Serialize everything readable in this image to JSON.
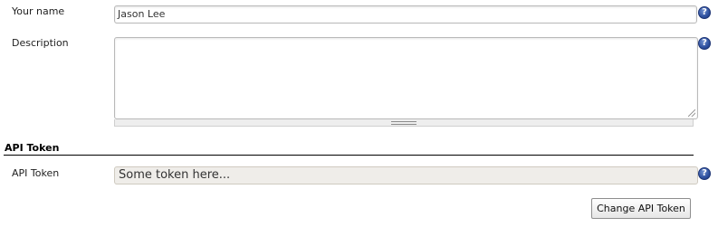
{
  "fields": {
    "name": {
      "label": "Your name",
      "value": "Jason Lee"
    },
    "description": {
      "label": "Description",
      "value": ""
    }
  },
  "api_section": {
    "header": "API Token",
    "token": {
      "label": "API Token",
      "value": "Some token here..."
    },
    "change_button": "Change API Token"
  },
  "help": {
    "glyph": "?"
  },
  "icons": {
    "help": "help-icon",
    "resize": "resize-grip-icon"
  },
  "colors": {
    "help_icon": "#2d4f9e",
    "token_background": "#efede9",
    "section_rule": "#000000"
  }
}
